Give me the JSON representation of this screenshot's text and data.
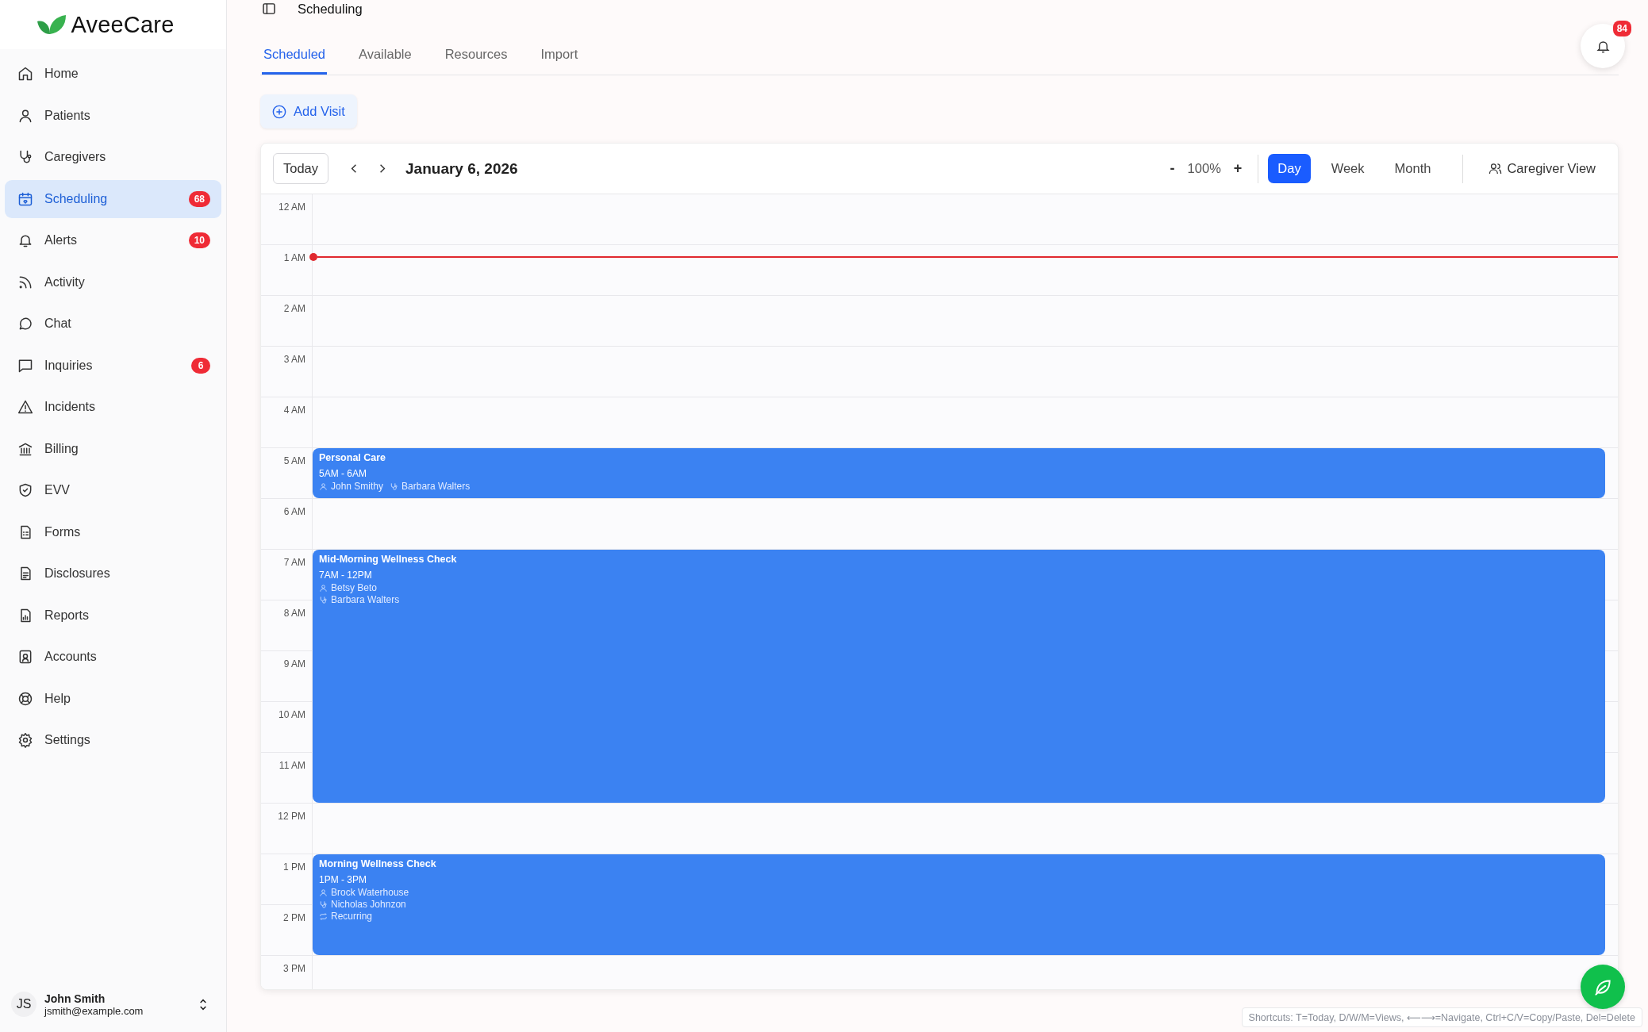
{
  "logo": {
    "text": "AveeCare"
  },
  "sidebar": {
    "items": [
      {
        "label": "Home",
        "selected": false
      },
      {
        "label": "Patients",
        "selected": false
      },
      {
        "label": "Caregivers",
        "selected": false
      },
      {
        "label": "Scheduling",
        "selected": true,
        "badge": "68"
      },
      {
        "label": "Alerts",
        "selected": false,
        "badge": "10"
      },
      {
        "label": "Activity",
        "selected": false
      },
      {
        "label": "Chat",
        "selected": false
      },
      {
        "label": "Inquiries",
        "selected": false,
        "badge": "6"
      },
      {
        "label": "Incidents",
        "selected": false
      },
      {
        "label": "Billing",
        "selected": false
      },
      {
        "label": "EVV",
        "selected": false
      },
      {
        "label": "Forms",
        "selected": false
      },
      {
        "label": "Disclosures",
        "selected": false
      },
      {
        "label": "Reports",
        "selected": false
      },
      {
        "label": "Accounts",
        "selected": false
      },
      {
        "label": "Help",
        "selected": false
      },
      {
        "label": "Settings",
        "selected": false
      }
    ],
    "user": {
      "initials": "JS",
      "name": "John Smith",
      "email": "jsmith@example.com"
    }
  },
  "header": {
    "title": "Scheduling",
    "notifications": "84"
  },
  "tabs": [
    {
      "label": "Scheduled",
      "selected": true
    },
    {
      "label": "Available",
      "selected": false
    },
    {
      "label": "Resources",
      "selected": false
    },
    {
      "label": "Import",
      "selected": false
    }
  ],
  "add_button": "Add Visit",
  "calendar": {
    "today": "Today",
    "date": "January 6, 2026",
    "zoom_out": "-",
    "zoom": "100%",
    "zoom_in": "+",
    "views": [
      {
        "label": "Day",
        "selected": true
      },
      {
        "label": "Week",
        "selected": false
      },
      {
        "label": "Month",
        "selected": false
      }
    ],
    "caregiver_view": "Caregiver View",
    "segments": [
      {
        "hours": [
          {
            "label": "12 AM",
            "now": false
          },
          {
            "label": "1 AM",
            "now": true
          },
          {
            "label": "2 AM",
            "now": false
          },
          {
            "label": "3 AM",
            "now": false
          },
          {
            "label": "4 AM",
            "now": false
          }
        ]
      },
      {
        "hours": [
          {
            "label": "5 AM",
            "now": false
          }
        ],
        "visit": {
          "title": "Personal Care",
          "time": "5AM - 6AM",
          "details_inline": true,
          "details": [
            {
              "kind": "patient",
              "text": "John Smithy"
            },
            {
              "kind": "caregiver",
              "text": "Barbara Walters"
            }
          ]
        }
      },
      {
        "hours": [
          {
            "label": "6 AM",
            "now": false
          }
        ]
      },
      {
        "hours": [
          {
            "label": "7 AM",
            "now": false
          },
          {
            "label": "8 AM",
            "now": false
          },
          {
            "label": "9 AM",
            "now": false
          },
          {
            "label": "10 AM",
            "now": false
          },
          {
            "label": "11 AM",
            "now": false
          }
        ],
        "visit": {
          "title": "Mid-Morning Wellness Check",
          "time": "7AM - 12PM",
          "details_inline": false,
          "details": [
            {
              "kind": "patient",
              "text": "Betsy Beto"
            },
            {
              "kind": "caregiver",
              "text": "Barbara Walters"
            }
          ]
        }
      },
      {
        "hours": [
          {
            "label": "12 PM",
            "now": false
          }
        ]
      },
      {
        "hours": [
          {
            "label": "1 PM",
            "now": false
          },
          {
            "label": "2 PM",
            "now": false
          }
        ],
        "visit": {
          "title": "Morning Wellness Check",
          "time": "1PM - 3PM",
          "details_inline": false,
          "details": [
            {
              "kind": "patient",
              "text": "Brock Waterhouse"
            },
            {
              "kind": "caregiver",
              "text": "Nicholas Johnzon"
            },
            {
              "kind": "recurring",
              "text": "Recurring"
            }
          ]
        }
      },
      {
        "hours": [
          {
            "label": "3 PM",
            "now": false
          }
        ]
      }
    ]
  },
  "shortcuts": "Shortcuts: T=Today, D/W/M=Views, ⟵⟶=Navigate, Ctrl+C/V=Copy/Paste, Del=Delete"
}
